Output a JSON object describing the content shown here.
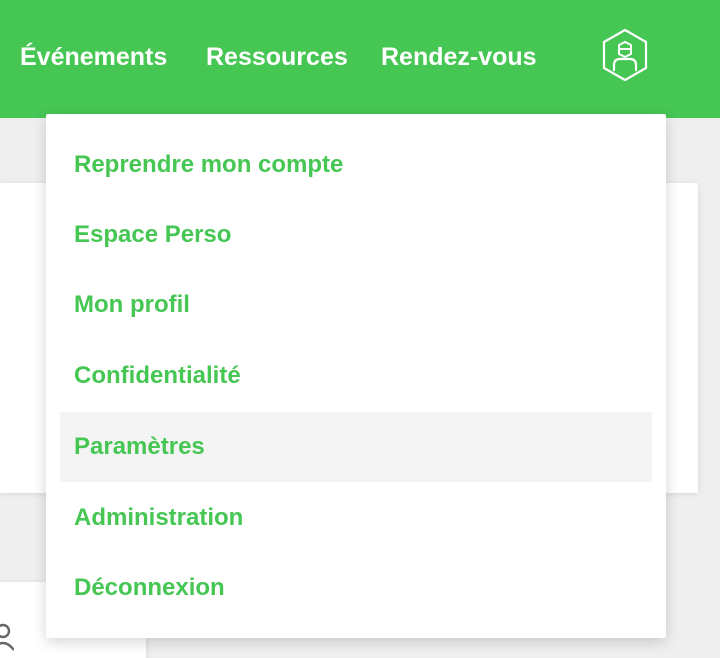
{
  "navbar": {
    "items": [
      {
        "label": "Événements"
      },
      {
        "label": "Ressources"
      },
      {
        "label": "Rendez-vous"
      }
    ],
    "user_icon": "hexagon-user-icon",
    "color": "#46c653"
  },
  "dropdown": {
    "items": [
      {
        "label": "Reprendre mon compte"
      },
      {
        "label": "Espace Perso"
      },
      {
        "label": "Mon profil"
      },
      {
        "label": "Confidentialité"
      },
      {
        "label": "Paramètres",
        "highlighted": true
      },
      {
        "label": "Administration"
      },
      {
        "label": "Déconnexion"
      }
    ],
    "text_color": "#46c653",
    "highlight_color": "#f4f4f4"
  },
  "background": {
    "partial_icon": "user-icon"
  }
}
